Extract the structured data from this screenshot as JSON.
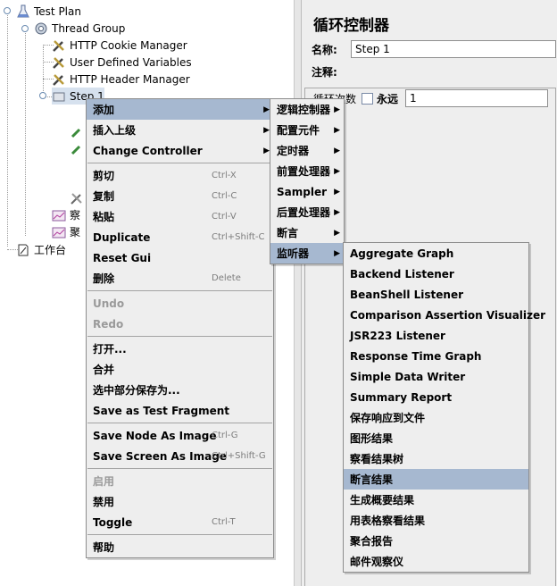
{
  "tree": {
    "items": [
      {
        "label": "Test Plan",
        "icon": "flask-icon"
      },
      {
        "label": "Thread Group",
        "icon": "gear-icon"
      },
      {
        "label": "HTTP Cookie Manager",
        "icon": "wrench-icon"
      },
      {
        "label": "User Defined Variables",
        "icon": "wrench-icon"
      },
      {
        "label": "HTTP Header Manager",
        "icon": "wrench-icon"
      },
      {
        "label": "Step 1",
        "icon": "loop-controller-icon"
      },
      {
        "label": "察",
        "icon": "chart-icon"
      },
      {
        "label": "聚",
        "icon": "chart-icon"
      },
      {
        "label": "工作台",
        "icon": "workbench-icon"
      }
    ]
  },
  "panel": {
    "title": "循环控制器",
    "name_label": "名称:",
    "name_value": "Step 1",
    "comment_label": "注释:",
    "loop_label": "循环次数",
    "forever_label": "永远",
    "loop_value": "1"
  },
  "context_menu": {
    "items": [
      {
        "label": "添加",
        "has_submenu": true,
        "highlighted": true
      },
      {
        "label": "插入上级",
        "has_submenu": true
      },
      {
        "label": "Change Controller",
        "has_submenu": true
      },
      {
        "separator": true
      },
      {
        "label": "剪切",
        "accel": "Ctrl-X"
      },
      {
        "label": "复制",
        "accel": "Ctrl-C"
      },
      {
        "label": "粘贴",
        "accel": "Ctrl-V"
      },
      {
        "label": "Duplicate",
        "accel": "Ctrl+Shift-C"
      },
      {
        "label": "Reset Gui"
      },
      {
        "label": "删除",
        "accel": "Delete"
      },
      {
        "separator": true
      },
      {
        "label": "Undo",
        "disabled": true
      },
      {
        "label": "Redo",
        "disabled": true
      },
      {
        "separator": true
      },
      {
        "label": "打开..."
      },
      {
        "label": "合并"
      },
      {
        "label": "选中部分保存为..."
      },
      {
        "label": "Save as Test Fragment"
      },
      {
        "separator": true
      },
      {
        "label": "Save Node As Image",
        "accel": "Ctrl-G"
      },
      {
        "label": "Save Screen As Image",
        "accel": "Ctrl+Shift-G"
      },
      {
        "separator": true
      },
      {
        "label": "启用",
        "disabled": true
      },
      {
        "label": "禁用"
      },
      {
        "label": "Toggle",
        "accel": "Ctrl-T"
      },
      {
        "separator": true
      },
      {
        "label": "帮助"
      }
    ]
  },
  "add_submenu": {
    "items": [
      {
        "label": "逻辑控制器",
        "has_submenu": true
      },
      {
        "label": "配置元件",
        "has_submenu": true
      },
      {
        "label": "定时器",
        "has_submenu": true
      },
      {
        "label": "前置处理器",
        "has_submenu": true
      },
      {
        "label": "Sampler",
        "has_submenu": true
      },
      {
        "label": "后置处理器",
        "has_submenu": true
      },
      {
        "label": "断言",
        "has_submenu": true
      },
      {
        "label": "监听器",
        "has_submenu": true,
        "highlighted": true
      }
    ]
  },
  "listener_submenu": {
    "items": [
      {
        "label": "Aggregate Graph"
      },
      {
        "label": "Backend Listener"
      },
      {
        "label": "BeanShell Listener"
      },
      {
        "label": "Comparison Assertion Visualizer"
      },
      {
        "label": "JSR223 Listener"
      },
      {
        "label": "Response Time Graph"
      },
      {
        "label": "Simple Data Writer"
      },
      {
        "label": "Summary Report"
      },
      {
        "label": "保存响应到文件"
      },
      {
        "label": "图形结果"
      },
      {
        "label": "察看结果树"
      },
      {
        "label": "断言结果",
        "highlighted": true
      },
      {
        "label": "生成概要结果"
      },
      {
        "label": "用表格察看结果"
      },
      {
        "label": "聚合报告"
      },
      {
        "label": "邮件观察仪"
      }
    ]
  },
  "colors": {
    "highlight": "#a6b8d0",
    "menu_bg": "#eeeeee",
    "tree_bg": "#ffffff"
  }
}
